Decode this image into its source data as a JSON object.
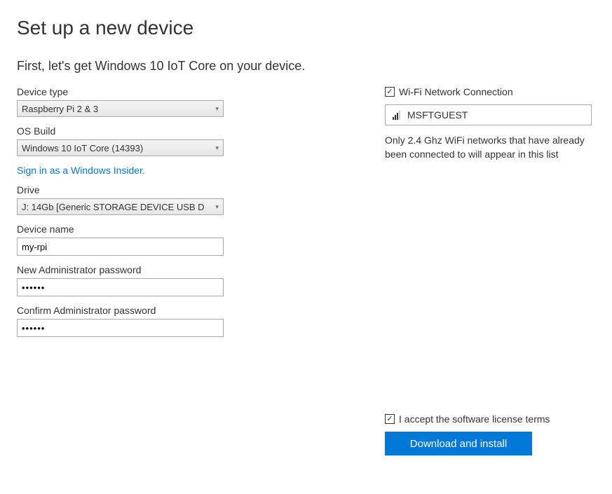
{
  "title": "Set up a new device",
  "subtitle": "First, let's get Windows 10 IoT Core on your device.",
  "form": {
    "deviceTypeLabel": "Device type",
    "deviceTypeValue": "Raspberry Pi 2 & 3",
    "osBuildLabel": "OS Build",
    "osBuildValue": "Windows 10 IoT Core (14393)",
    "insiderLink": "Sign in as a Windows Insider.",
    "driveLabel": "Drive",
    "driveValue": "J: 14Gb [Generic STORAGE DEVICE USB D",
    "deviceNameLabel": "Device name",
    "deviceNameValue": "my-rpi",
    "newPasswordLabel": "New Administrator password",
    "newPasswordValue": "••••••",
    "confirmPasswordLabel": "Confirm Administrator password",
    "confirmPasswordValue": "••••••"
  },
  "wifi": {
    "checkboxLabel": "Wi-Fi Network Connection",
    "networkName": "MSFTGUEST",
    "hint": "Only 2.4 Ghz WiFi networks that have already been connected to will appear in this list"
  },
  "license": {
    "label": "I accept the software license terms"
  },
  "button": {
    "label": "Download and install"
  }
}
